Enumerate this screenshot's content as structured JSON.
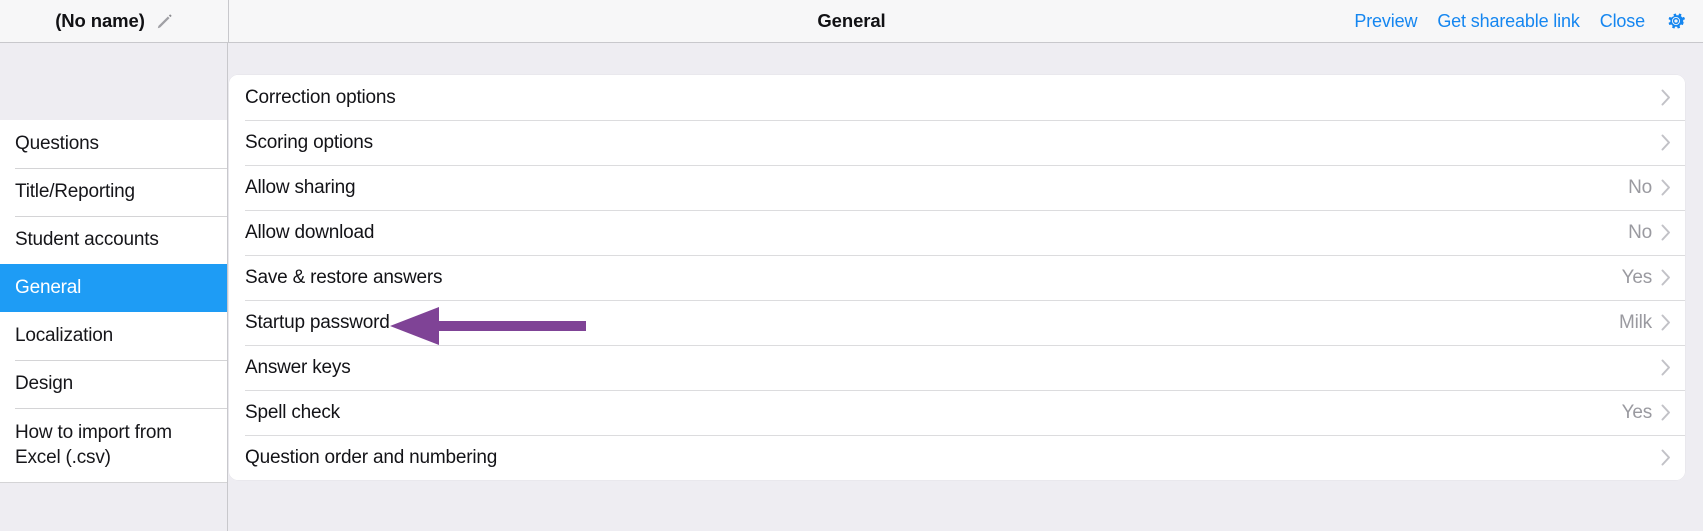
{
  "header": {
    "doc_title": "(No name)",
    "edit_icon": "pencil-icon",
    "page_title": "General",
    "actions": [
      {
        "label": "Preview",
        "name": "preview-link"
      },
      {
        "label": "Get shareable link",
        "name": "get-shareable-link"
      },
      {
        "label": "Close",
        "name": "close-link"
      }
    ],
    "settings_icon": "gear-icon",
    "link_color": "#1586f0"
  },
  "sidebar": {
    "active_color": "#1e9cf5",
    "items": [
      {
        "label": "Questions",
        "active": false
      },
      {
        "label": "Title/Reporting",
        "active": false
      },
      {
        "label": "Student accounts",
        "active": false
      },
      {
        "label": "General",
        "active": true
      },
      {
        "label": "Localization",
        "active": false
      },
      {
        "label": "Design",
        "active": false
      },
      {
        "label": "How to import from Excel (.csv)",
        "active": false
      }
    ]
  },
  "main": {
    "rows": [
      {
        "label": "Correction options",
        "value": ""
      },
      {
        "label": "Scoring options",
        "value": ""
      },
      {
        "label": "Allow sharing",
        "value": "No"
      },
      {
        "label": "Allow download",
        "value": "No"
      },
      {
        "label": "Save & restore answers",
        "value": "Yes"
      },
      {
        "label": "Startup password",
        "value": "Milk"
      },
      {
        "label": "Answer keys",
        "value": ""
      },
      {
        "label": "Spell check",
        "value": "Yes"
      },
      {
        "label": "Question order and numbering",
        "value": ""
      }
    ],
    "chevron_icon": "chevron-right-icon"
  },
  "annotation": {
    "icon": "arrow-left-icon",
    "color": "#7f4396",
    "points_to": "Startup password"
  }
}
